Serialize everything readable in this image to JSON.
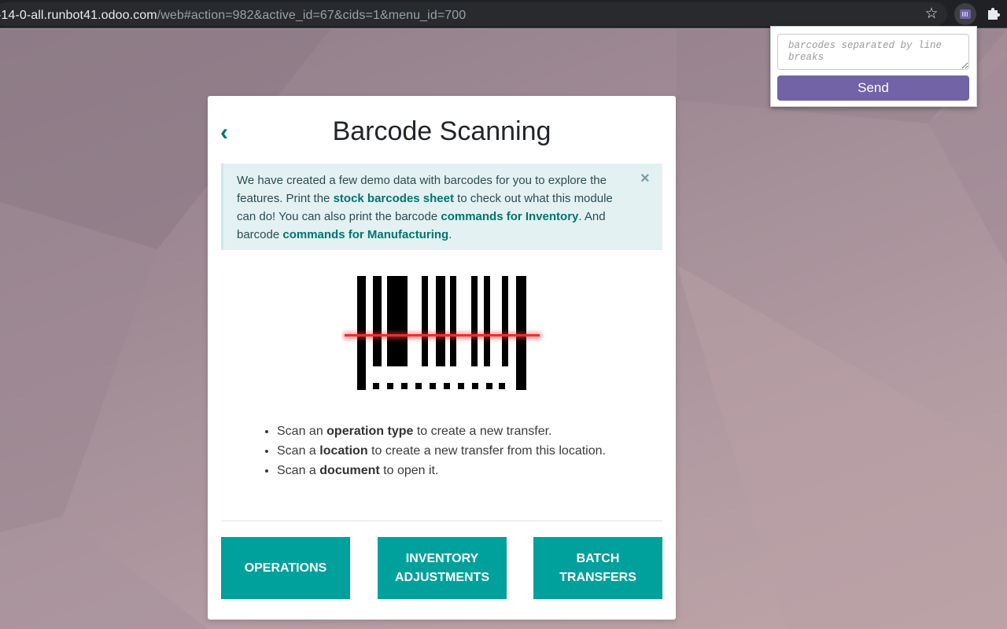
{
  "browser": {
    "url_host": "-14-0-all.runbot41.odoo.com",
    "url_path": "/web#action=982&active_id=67&cids=1&menu_id=700",
    "icons": [
      "star-icon",
      "barcode-extension-icon",
      "puzzle-icon"
    ]
  },
  "extension_popup": {
    "placeholder": "barcodes separated by line breaks",
    "send_label": "Send",
    "accent_color": "#7163a6"
  },
  "dialog": {
    "title": "Barcode Scanning",
    "back_icon": "chevron-left-icon",
    "alert": {
      "text_1": "We have created a few demo data with barcodes for you to explore the features. Print the ",
      "link_1": "stock barcodes sheet",
      "text_2": " to check out what this module can do! You can also print the barcode ",
      "link_2": "commands for Inventory",
      "text_3": ". And barcode ",
      "link_3": "commands for Manufacturing",
      "text_4": ".",
      "close": "×"
    },
    "instructions": [
      {
        "pre": "Scan an ",
        "bold": "operation type",
        "post": " to create a new transfer."
      },
      {
        "pre": "Scan a ",
        "bold": "location",
        "post": " to create a new transfer from this location."
      },
      {
        "pre": "Scan a ",
        "bold": "document",
        "post": " to open it."
      }
    ],
    "buttons": {
      "operations": "OPERATIONS",
      "inventory_adjustments": "INVENTORY ADJUSTMENTS",
      "batch_transfers": "BATCH TRANSFERS"
    },
    "brand_color": "#00a09d",
    "link_color": "#00756f"
  }
}
